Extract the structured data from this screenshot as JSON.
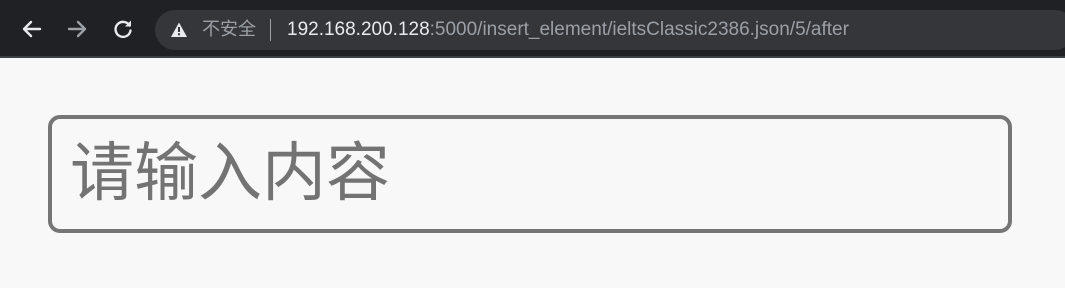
{
  "browser": {
    "security_label": "不安全",
    "url_host": "192.168.200.128",
    "url_rest": ":5000/insert_element/ieltsClassic2386.json/5/after",
    "icons": {
      "back": "arrow-left-icon",
      "forward": "arrow-right-icon",
      "reload": "reload-icon",
      "security": "warning-triangle-icon"
    }
  },
  "main": {
    "input": {
      "value": "",
      "placeholder": "请输入内容"
    }
  },
  "colors": {
    "toolbar": "#202124",
    "omnibox": "#35363a",
    "page_background": "#f8f8f8",
    "input_border": "#767676",
    "placeholder": "#737373"
  }
}
